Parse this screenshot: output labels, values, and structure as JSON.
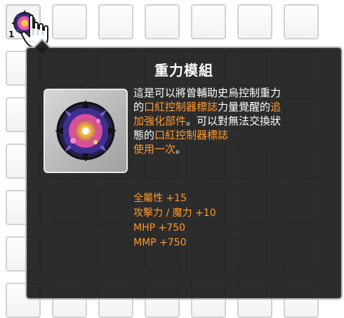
{
  "inventory": {
    "first_slot_quantity": "1"
  },
  "tooltip": {
    "item_name": "重力模組",
    "description_lines": [
      [
        {
          "t": "這是可以將曾輔助史烏控制重力",
          "hl": false
        }
      ],
      [
        {
          "t": "的",
          "hl": false
        },
        {
          "t": "口紅控制器標誌",
          "hl": true
        },
        {
          "t": "力量覺醒的",
          "hl": false
        },
        {
          "t": "追",
          "hl": true
        }
      ],
      [
        {
          "t": "加強化部件",
          "hl": true
        },
        {
          "t": "。可以對無法交換狀",
          "hl": false
        }
      ],
      [
        {
          "t": "態的",
          "hl": false
        },
        {
          "t": "口紅控制器標誌",
          "hl": true
        }
      ],
      [
        {
          "t": "使用一次",
          "hl": true
        },
        {
          "t": "。",
          "hl": false
        }
      ]
    ],
    "stats": [
      {
        "label": "全屬性",
        "value": "+15"
      },
      {
        "label": "攻擊力 / 魔力",
        "value": "+10"
      },
      {
        "label": "MHP",
        "value": "+750"
      },
      {
        "label": "MMP",
        "value": "+750"
      }
    ]
  },
  "colors": {
    "highlight": "#ff9a2e",
    "text": "#ffffff",
    "tooltip_bg": "#1c1c1c"
  }
}
